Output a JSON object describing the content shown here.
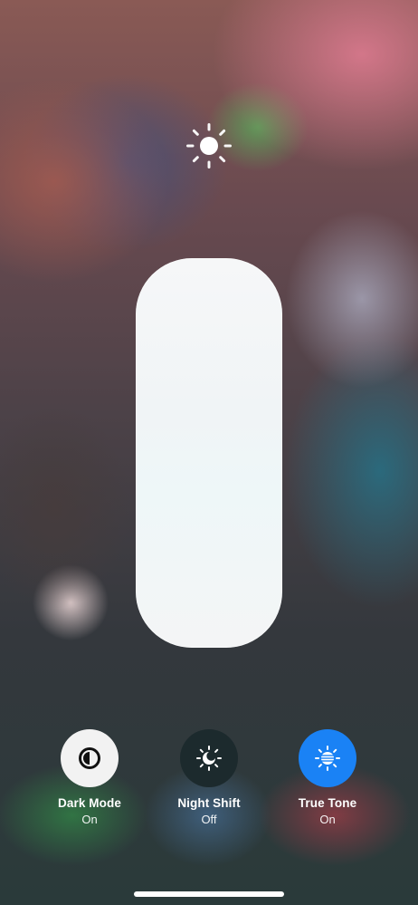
{
  "screen": {
    "title": "Brightness control"
  },
  "slider": {
    "level": 1.0
  },
  "controls": [
    {
      "id": "dark-mode",
      "label": "Dark Mode",
      "state": "On",
      "icon": "dark-mode-icon"
    },
    {
      "id": "night-shift",
      "label": "Night Shift",
      "state": "Off",
      "icon": "night-shift-icon"
    },
    {
      "id": "true-tone",
      "label": "True Tone",
      "state": "On",
      "icon": "true-tone-icon"
    }
  ],
  "colors": {
    "true_tone_active": "#1a82f5",
    "dark_mode_button": "#f2f2f2",
    "night_shift_button": "#1c2a2d"
  }
}
